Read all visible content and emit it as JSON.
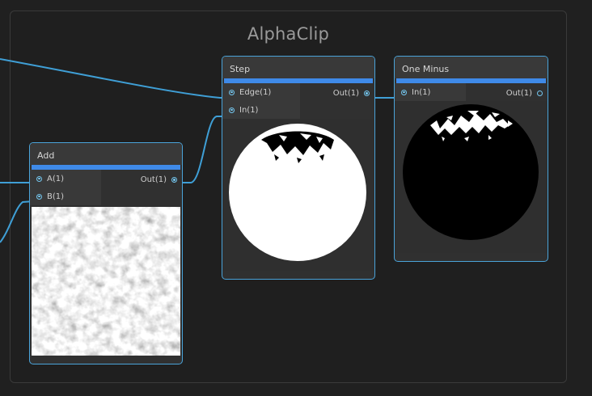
{
  "group": {
    "title": "AlphaClip"
  },
  "nodes": {
    "add": {
      "title": "Add",
      "inputs": [
        "A(1)",
        "B(1)"
      ],
      "output": "Out(1)"
    },
    "step": {
      "title": "Step",
      "inputs": [
        "Edge(1)",
        "In(1)"
      ],
      "output": "Out(1)"
    },
    "one_minus": {
      "title": "One Minus",
      "inputs": [
        "In(1)"
      ],
      "output": "Out(1)"
    }
  },
  "colors": {
    "node_border": "#4aa3d9",
    "header_bar": "#3f8ae8",
    "wire": "#3f9fd6",
    "background": "#202020"
  }
}
